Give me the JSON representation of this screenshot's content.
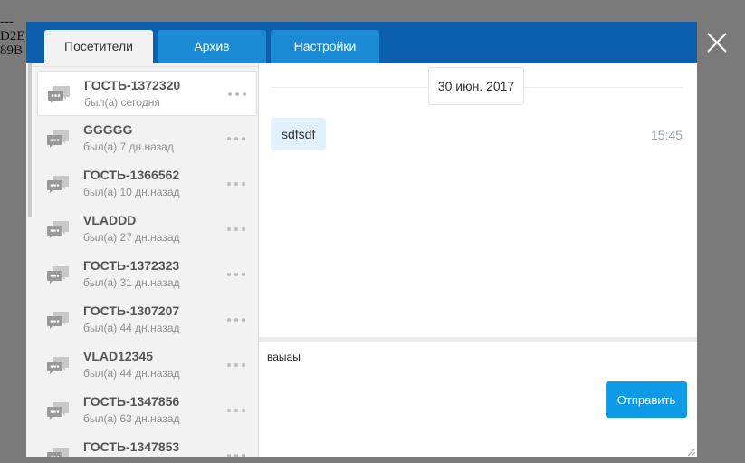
{
  "background_text": {
    "lines": [
      "---",
      "D2E",
      "89B"
    ]
  },
  "tabs": [
    {
      "label": "Посетители",
      "active": true
    },
    {
      "label": "Архив",
      "active": false
    },
    {
      "label": "Настройки",
      "active": false
    }
  ],
  "visitors": [
    {
      "name": "ГОСТЬ-1372320",
      "seen": "был(а) сегодня",
      "selected": true
    },
    {
      "name": "GGGGG",
      "seen": "был(а) 7 дн.назад"
    },
    {
      "name": "ГОСТЬ-1366562",
      "seen": "был(а) 10 дн.назад"
    },
    {
      "name": "VLADDD",
      "seen": "был(а) 27 дн.назад"
    },
    {
      "name": "ГОСТЬ-1372323",
      "seen": "был(а) 31 дн.назад"
    },
    {
      "name": "ГОСТЬ-1307207",
      "seen": "был(а) 44 дн.назад"
    },
    {
      "name": "VLAD12345",
      "seen": "был(а) 44 дн.назад"
    },
    {
      "name": "ГОСТЬ-1347856",
      "seen": "был(а) 63 дн.назад"
    },
    {
      "name": "ГОСТЬ-1347853",
      "seen": ""
    }
  ],
  "chat": {
    "date": "30 июн. 2017",
    "messages": [
      {
        "text": "sdfsdf",
        "time": "15:45"
      }
    ]
  },
  "composer": {
    "value": "ваыаы",
    "send_label": "Отправить"
  },
  "colors": {
    "header": "#0b5fac",
    "tab": "#1c8bd6",
    "send_button": "#0e9ae6",
    "bubble": "#e0f0fc"
  },
  "icons": {
    "close": "close-icon",
    "visitor": "chat-bubbles-icon",
    "menu": "more-dots-icon"
  }
}
